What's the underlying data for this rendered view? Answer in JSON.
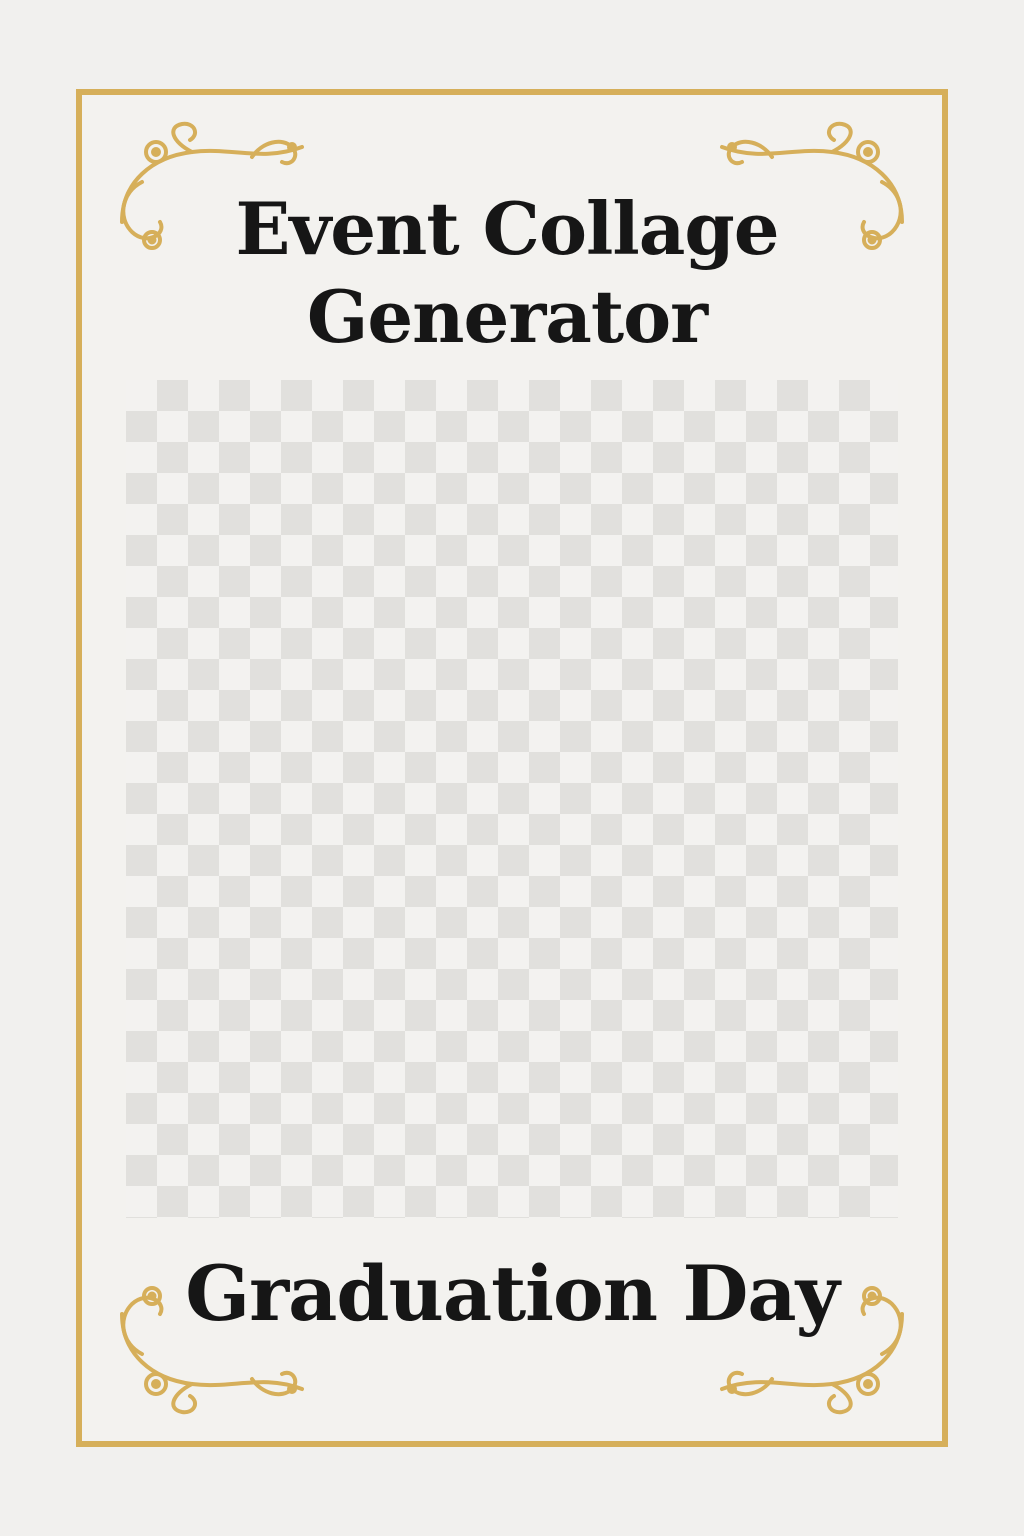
{
  "title": {
    "line1": "Event Collage",
    "line2": "Generator"
  },
  "event_name": "Graduation Day",
  "colors": {
    "background": "#f1f0ee",
    "gold_border": "#d6af5a",
    "text": "#161616",
    "checker_light": "#f3f2f0",
    "checker_dark": "#e1e0dd"
  },
  "ornaments": [
    "flourish-icon",
    "flourish-icon",
    "flourish-icon",
    "flourish-icon"
  ]
}
